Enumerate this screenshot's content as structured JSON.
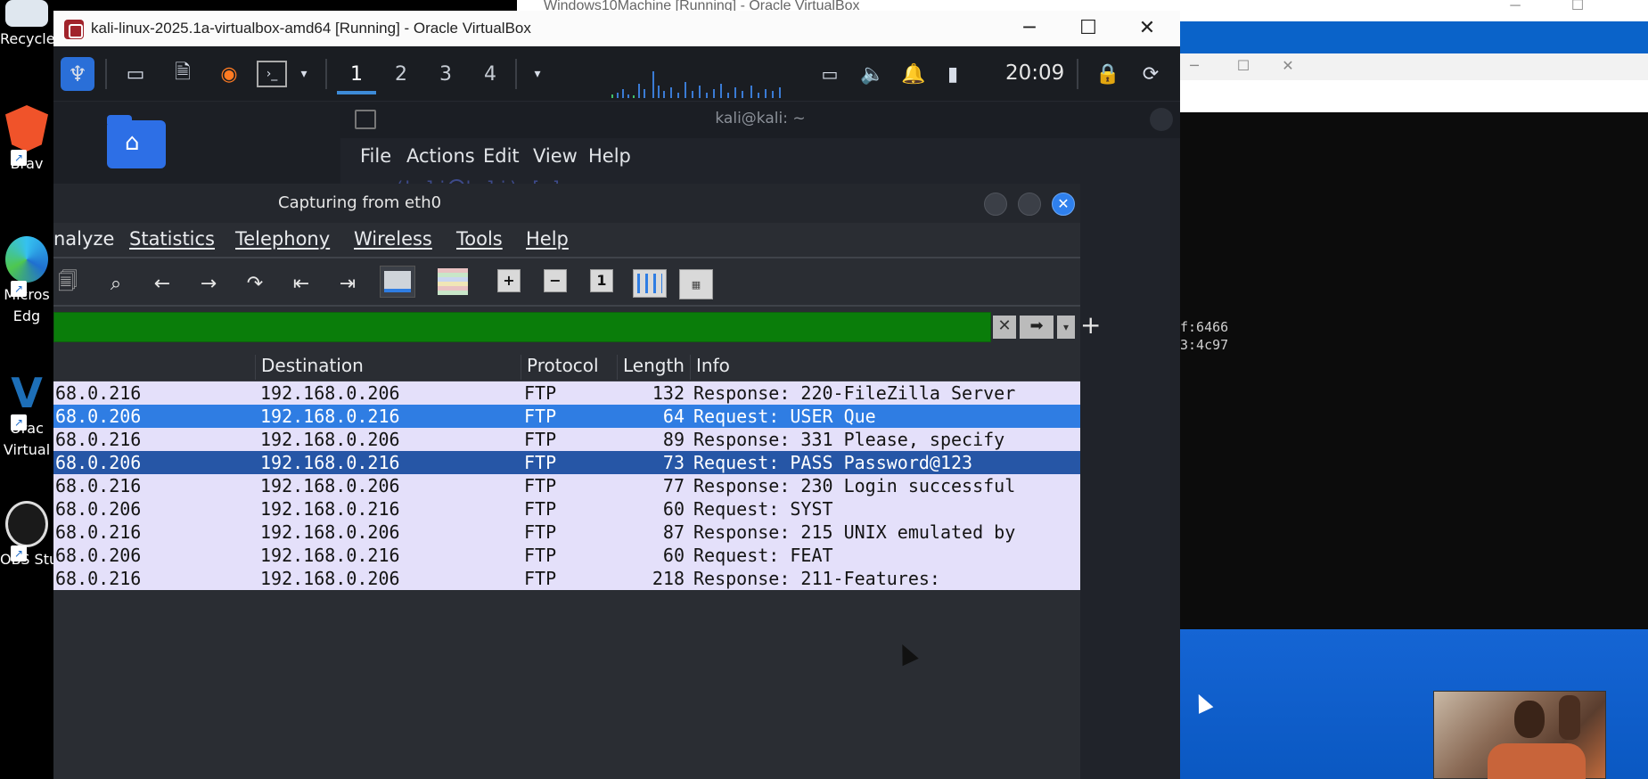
{
  "host": {
    "desktop_icons": [
      {
        "label": "Recycle",
        "icon": "recycle-bin-icon"
      },
      {
        "label": "Brav",
        "icon": "brave-browser-icon"
      },
      {
        "label": "Micros",
        "label2": "Edg",
        "icon": "edge-browser-icon"
      },
      {
        "label": "Orac",
        "label2": "Virtual",
        "icon": "virtualbox-icon"
      },
      {
        "label": "OBS Stu",
        "icon": "obs-studio-icon"
      }
    ],
    "bg_window_title": "Windows10Machine [Running] - Oracle VirtualBox",
    "cmd_lines": [
      "f:6466",
      "3:4c97"
    ]
  },
  "vbox": {
    "title": "kali-linux-2025.1a-virtualbox-amd64 [Running] - Oracle VirtualBox",
    "controls": {
      "minimize": "─",
      "maximize": "☐",
      "close": "✕"
    }
  },
  "kali_panel": {
    "workspaces": [
      "1",
      "2",
      "3",
      "4"
    ],
    "active_workspace": 0,
    "clock": "20:09"
  },
  "terminal": {
    "title": "kali@kali: ~",
    "menu": [
      "File",
      "Actions",
      "Edit",
      "View",
      "Help"
    ],
    "prompt_fragment": "(kali㉿kali)-[~]"
  },
  "wireshark": {
    "title": "Capturing from eth0",
    "menu": [
      "nalyze",
      "Statistics",
      "Telephony",
      "Wireless",
      "Tools",
      "Help"
    ],
    "filter_value": "",
    "columns": [
      "Destination",
      "Protocol",
      "Length",
      "Info"
    ],
    "rows": [
      {
        "src": "68.0.216",
        "dst": "192.168.0.206",
        "proto": "FTP",
        "len": "132",
        "info": "Response: 220-FileZilla Server",
        "style": "normal"
      },
      {
        "src": "68.0.206",
        "dst": "192.168.0.216",
        "proto": "FTP",
        "len": "64",
        "info": "Request: USER Que",
        "style": "sel1"
      },
      {
        "src": "68.0.216",
        "dst": "192.168.0.206",
        "proto": "FTP",
        "len": "89",
        "info": "Response: 331 Please, specify",
        "style": "normal"
      },
      {
        "src": "68.0.206",
        "dst": "192.168.0.216",
        "proto": "FTP",
        "len": "73",
        "info": "Request: PASS Password@123",
        "style": "sel2"
      },
      {
        "src": "68.0.216",
        "dst": "192.168.0.206",
        "proto": "FTP",
        "len": "77",
        "info": "Response: 230 Login successful",
        "style": "normal"
      },
      {
        "src": "68.0.206",
        "dst": "192.168.0.216",
        "proto": "FTP",
        "len": "60",
        "info": "Request: SYST",
        "style": "normal"
      },
      {
        "src": "68.0.216",
        "dst": "192.168.0.206",
        "proto": "FTP",
        "len": "87",
        "info": "Response: 215 UNIX emulated by",
        "style": "normal"
      },
      {
        "src": "68.0.206",
        "dst": "192.168.0.216",
        "proto": "FTP",
        "len": "60",
        "info": "Request: FEAT",
        "style": "normal"
      },
      {
        "src": "68.0.216",
        "dst": "192.168.0.206",
        "proto": "FTP",
        "len": "218",
        "info": "Response: 211-Features:",
        "style": "normal"
      }
    ]
  },
  "colors": {
    "kali_panel_bg": "#1a1d22",
    "filter_green": "#0a7d0a",
    "row_bg": "#e4e0fa",
    "row_selected": "#2f7de3",
    "row_selected_dark": "#2656a6",
    "host_blue": "#0a63c9"
  }
}
